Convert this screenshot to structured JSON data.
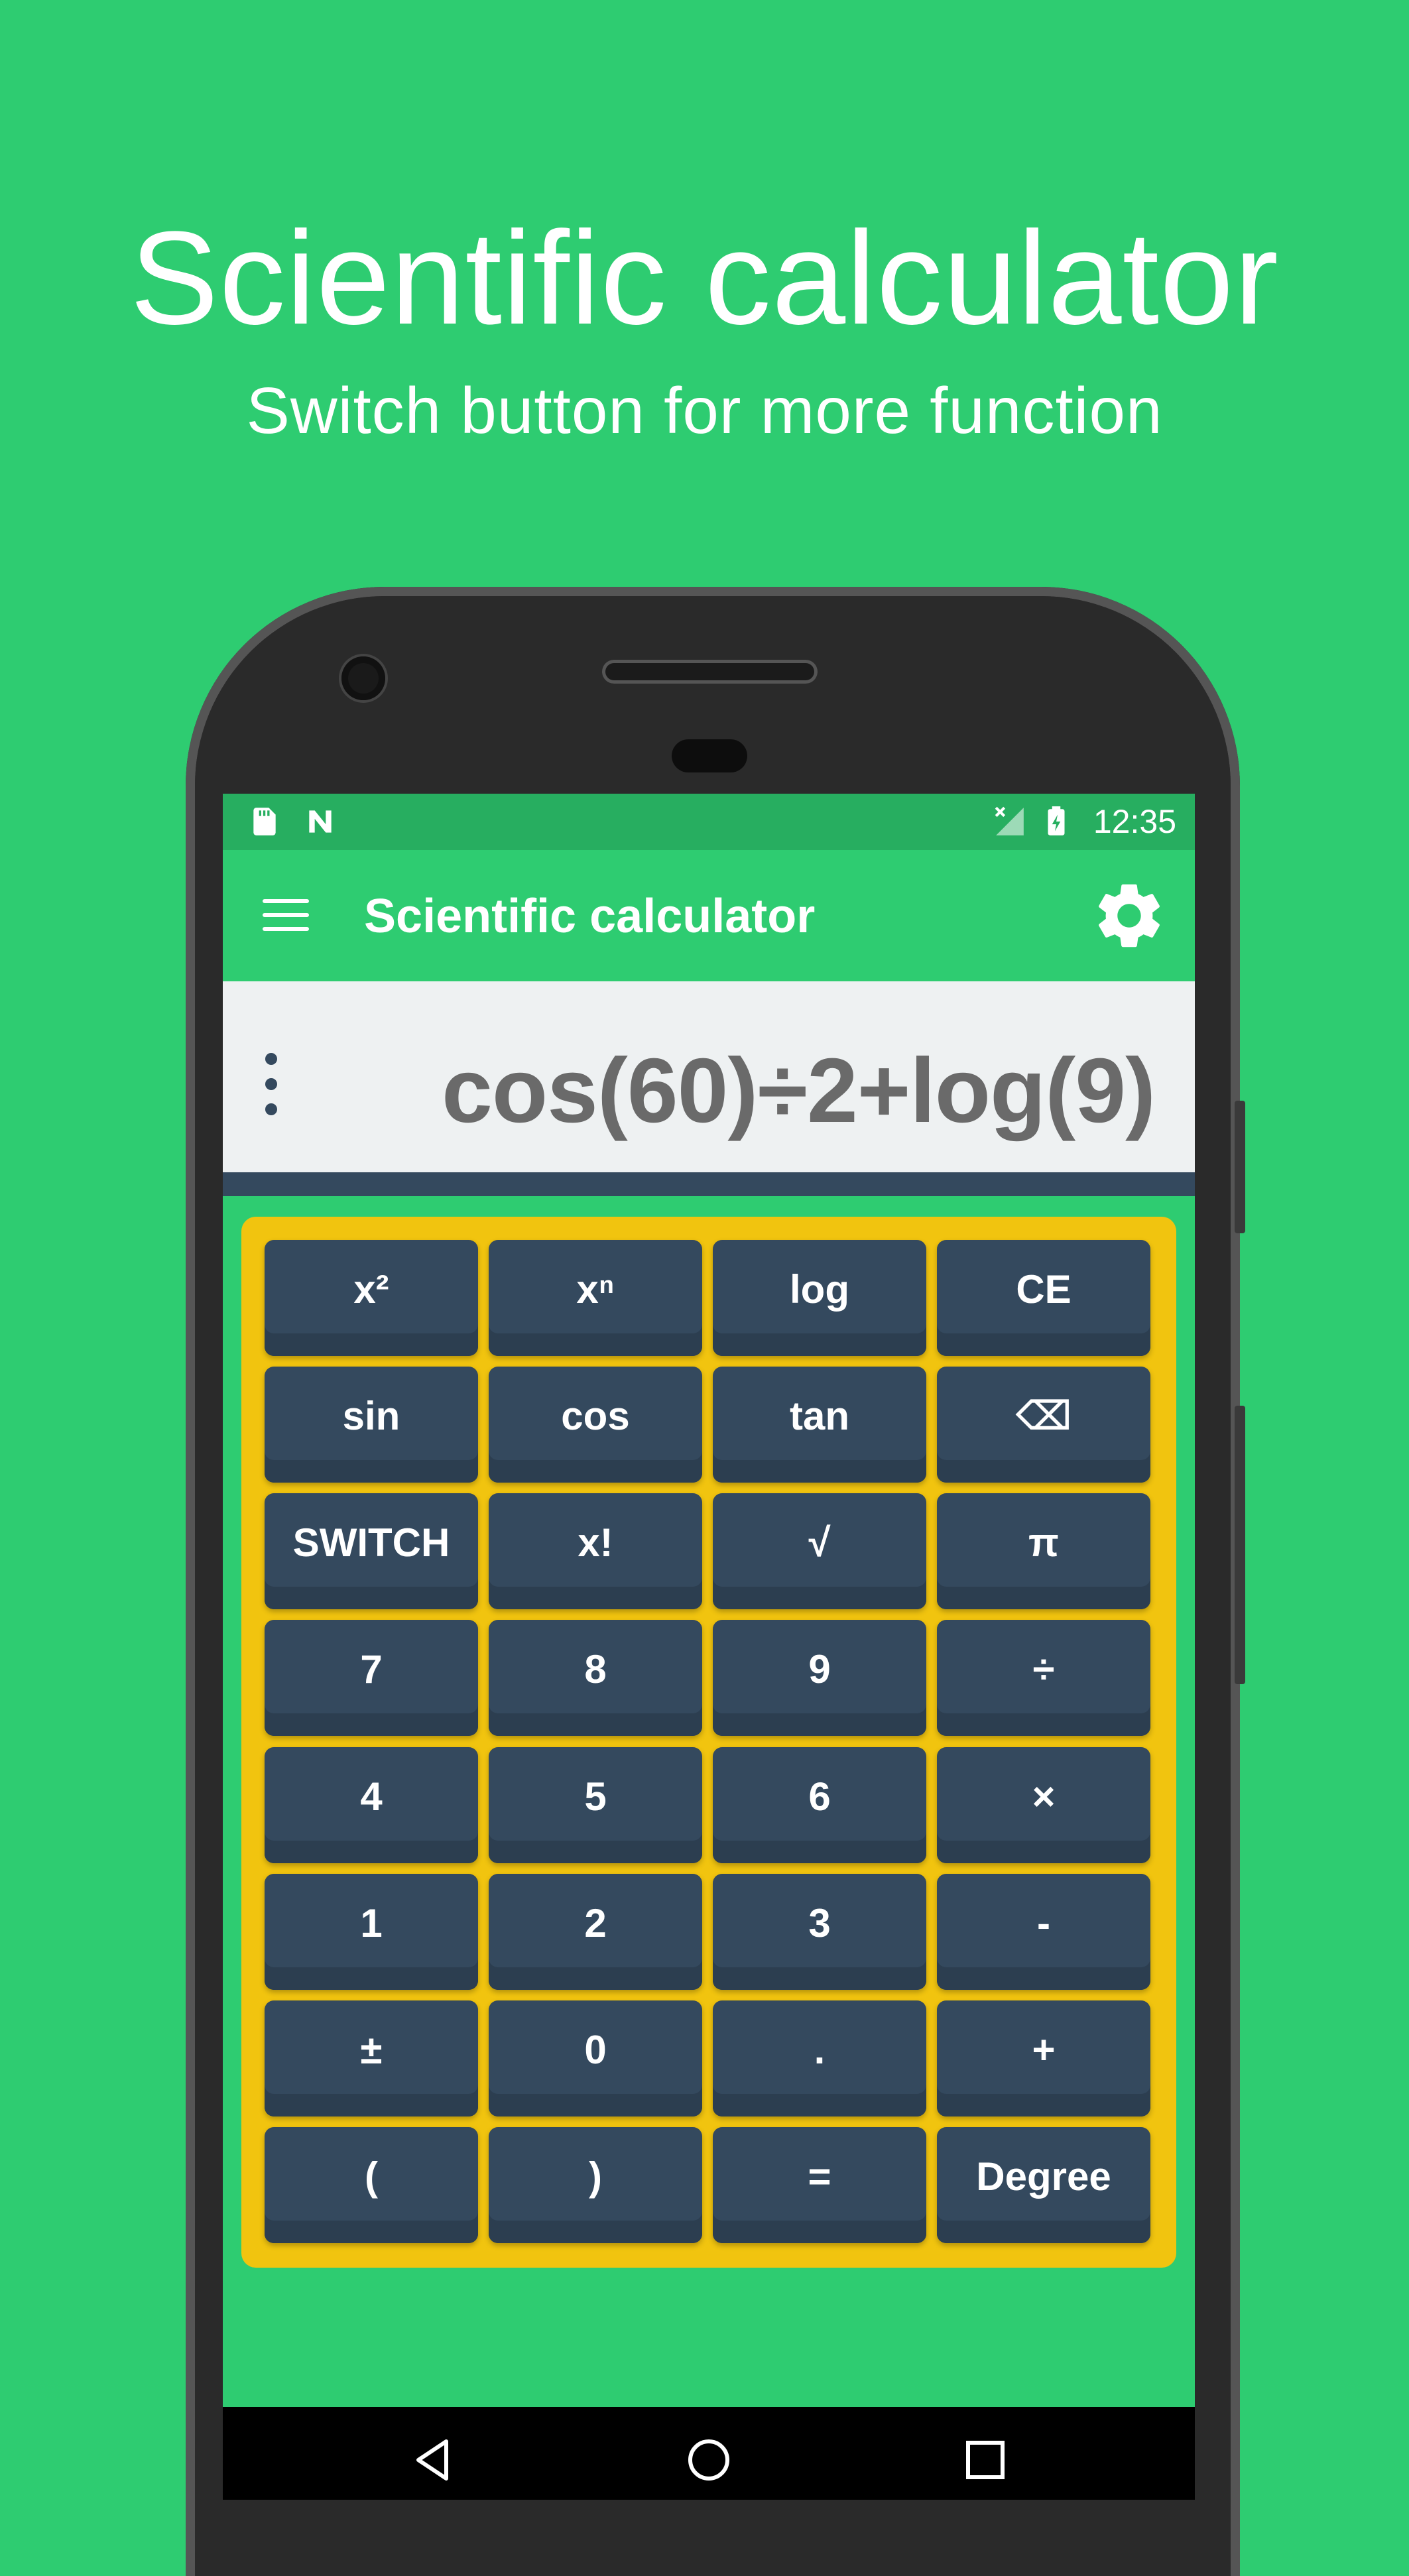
{
  "promo": {
    "title": "Scientific calculator",
    "subtitle": "Switch button for more function"
  },
  "status_bar": {
    "time": "12:35",
    "left_icons": [
      "sd-card-icon",
      "n-notification-icon"
    ],
    "right_icons": [
      "no-signal-icon",
      "battery-charging-icon"
    ]
  },
  "app_bar": {
    "title": "Scientific calculator",
    "menu_icon": "hamburger-menu-icon",
    "settings_icon": "gear-icon"
  },
  "display": {
    "expression": "cos(60)÷2+log(9)",
    "more_icon": "vertical-dots-icon"
  },
  "keys": [
    [
      "x²",
      "xⁿ",
      "log",
      "CE"
    ],
    [
      "sin",
      "cos",
      "tan",
      "⌫"
    ],
    [
      "SWITCH",
      "x!",
      "√",
      "π"
    ],
    [
      "7",
      "8",
      "9",
      "÷"
    ],
    [
      "4",
      "5",
      "6",
      "×"
    ],
    [
      "1",
      "2",
      "3",
      "-"
    ],
    [
      "±",
      "0",
      ".",
      "+"
    ],
    [
      "(",
      ")",
      "=",
      "Degree"
    ]
  ],
  "nav_bar": {
    "icons": [
      "back-icon",
      "home-icon",
      "recents-icon"
    ]
  },
  "colors": {
    "background": "#2ecc71",
    "status_bar": "#27ae60",
    "keypad_frame": "#f1c40f",
    "key": "#34495e",
    "expression_text": "#6a6a6a"
  }
}
